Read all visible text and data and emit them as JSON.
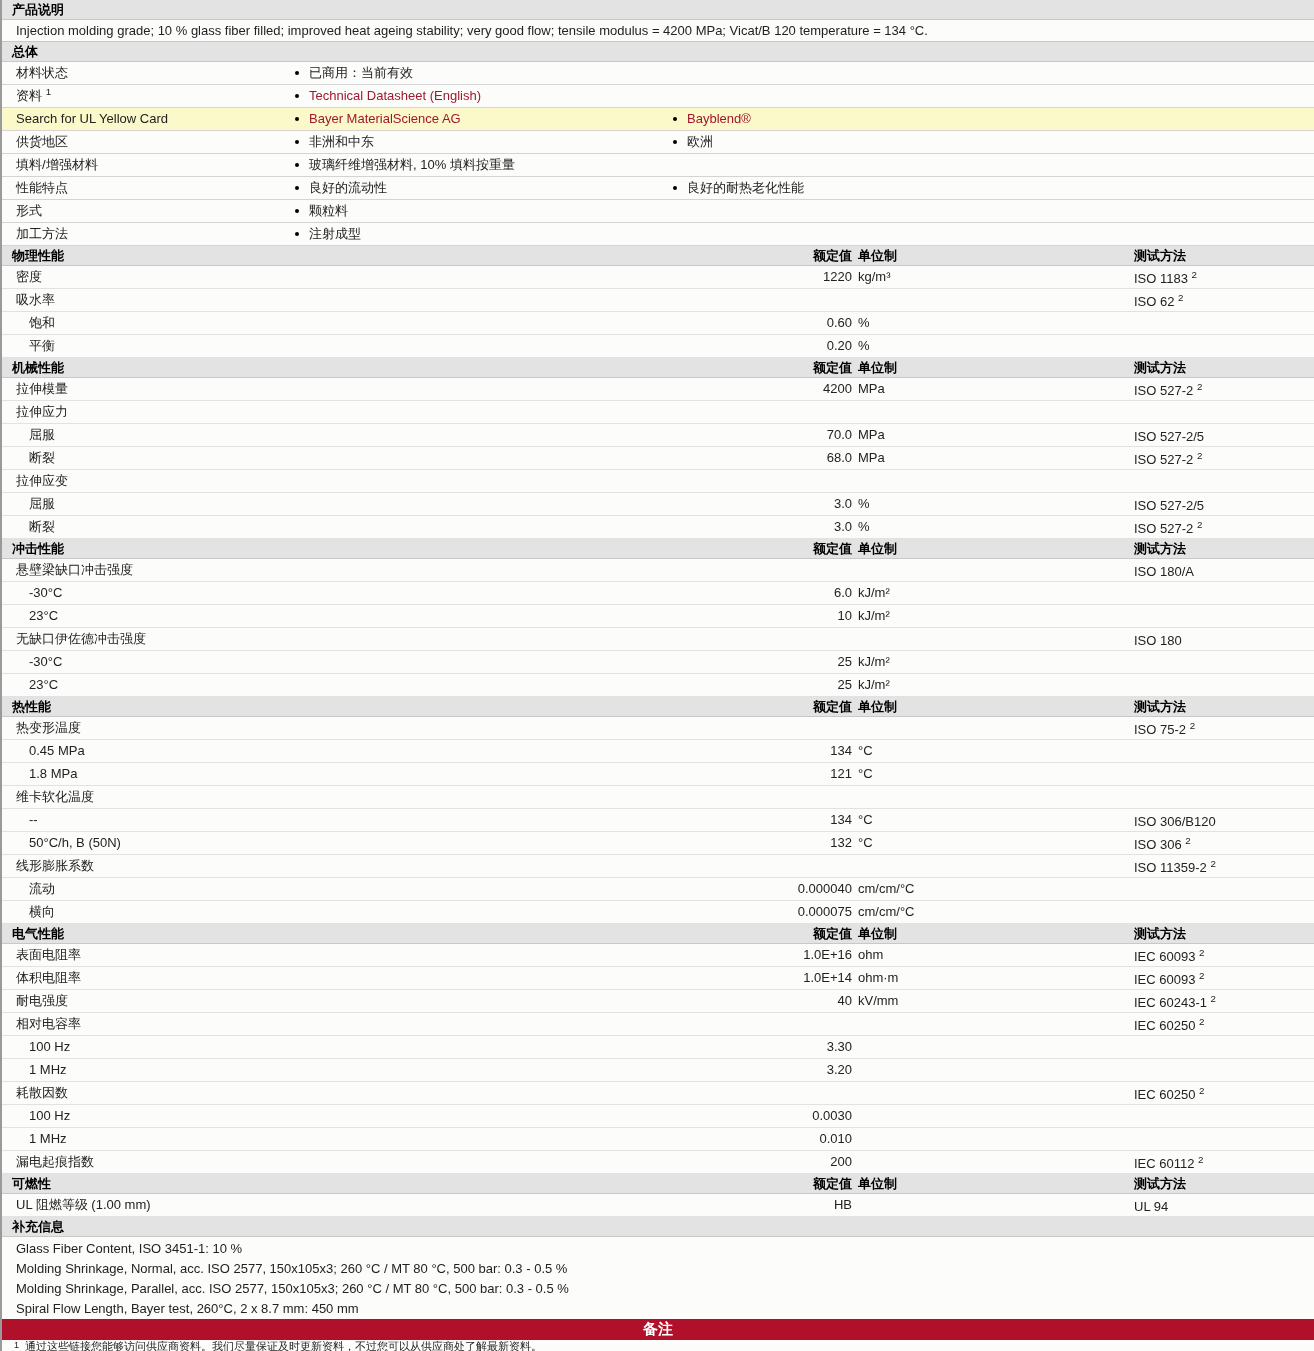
{
  "description": {
    "title": "产品说明",
    "text": "Injection molding grade; 10 % glass fiber filled; improved heat ageing stability; very good flow; tensile modulus = 4200 MPa; Vicat/B 120 temperature = 134 °C."
  },
  "general": {
    "title": "总体",
    "rows": [
      {
        "label": "材料状态",
        "highlighted": false,
        "values": [
          {
            "text": "已商用：当前有效",
            "link": false
          }
        ]
      },
      {
        "label": "资料 $^{1}$",
        "highlighted": false,
        "values": [
          {
            "text": "Technical Datasheet (English)",
            "link": true
          }
        ]
      },
      {
        "label": "Search for UL Yellow Card",
        "highlighted": true,
        "values": [
          {
            "text": "Bayer MaterialScience AG",
            "link": true
          },
          {
            "text": "Bayblend®",
            "link": true
          }
        ]
      },
      {
        "label": "供货地区",
        "highlighted": false,
        "values": [
          {
            "text": "非洲和中东",
            "link": false
          },
          {
            "text": "欧洲",
            "link": false
          }
        ]
      },
      {
        "label": "填料/增强材料",
        "highlighted": false,
        "values": [
          {
            "text": "玻璃纤维增强材料, 10% 填料按重量",
            "link": false
          }
        ]
      },
      {
        "label": "性能特点",
        "highlighted": false,
        "values": [
          {
            "text": "良好的流动性",
            "link": false
          },
          {
            "text": "良好的耐热老化性能",
            "link": false
          }
        ]
      },
      {
        "label": "形式",
        "highlighted": false,
        "values": [
          {
            "text": "颗粒料",
            "link": false
          }
        ]
      },
      {
        "label": "加工方法",
        "highlighted": false,
        "values": [
          {
            "text": "注射成型",
            "link": false
          }
        ]
      }
    ]
  },
  "property_sections": [
    {
      "title": "物理性能",
      "value_heading": "额定值",
      "unit_heading": "单位制",
      "method_heading": "测试方法",
      "rows": [
        {
          "label": "密度",
          "indented": false,
          "value": "1220",
          "unit": "kg/m³",
          "method": "ISO 1183 $^{2}$"
        },
        {
          "label": "吸水率",
          "indented": false,
          "method": "ISO 62 $^{2}$"
        },
        {
          "label": "饱和",
          "indented": true,
          "value": "0.60",
          "unit": "%"
        },
        {
          "label": "平衡",
          "indented": true,
          "value": "0.20",
          "unit": "%"
        }
      ]
    },
    {
      "title": "机械性能",
      "value_heading": "额定值",
      "unit_heading": "单位制",
      "method_heading": "测试方法",
      "rows": [
        {
          "label": "拉伸模量",
          "indented": false,
          "value": "4200",
          "unit": "MPa",
          "method": "ISO 527-2 $^{2}$"
        },
        {
          "label": "拉伸应力",
          "indented": false
        },
        {
          "label": "屈服",
          "indented": true,
          "value": "70.0",
          "unit": "MPa",
          "method": "ISO 527-2/5"
        },
        {
          "label": "断裂",
          "indented": true,
          "value": "68.0",
          "unit": "MPa",
          "method": "ISO 527-2 $^{2}$"
        },
        {
          "label": "拉伸应变",
          "indented": false
        },
        {
          "label": "屈服",
          "indented": true,
          "value": "3.0",
          "unit": "%",
          "method": "ISO 527-2/5"
        },
        {
          "label": "断裂",
          "indented": true,
          "value": "3.0",
          "unit": "%",
          "method": "ISO 527-2 $^{2}$"
        }
      ]
    },
    {
      "title": "冲击性能",
      "value_heading": "额定值",
      "unit_heading": "单位制",
      "method_heading": "测试方法",
      "rows": [
        {
          "label": "悬壁梁缺口冲击强度",
          "indented": false,
          "method": "ISO 180/A"
        },
        {
          "label": "-30°C",
          "indented": true,
          "value": "6.0",
          "unit": "kJ/m²"
        },
        {
          "label": "23°C",
          "indented": true,
          "value": "10",
          "unit": "kJ/m²"
        },
        {
          "label": "无缺口伊佐德冲击强度",
          "indented": false,
          "method": "ISO 180"
        },
        {
          "label": "-30°C",
          "indented": true,
          "value": "25",
          "unit": "kJ/m²"
        },
        {
          "label": "23°C",
          "indented": true,
          "value": "25",
          "unit": "kJ/m²"
        }
      ]
    },
    {
      "title": "热性能",
      "value_heading": "额定值",
      "unit_heading": "单位制",
      "method_heading": "测试方法",
      "rows": [
        {
          "label": "热变形温度",
          "indented": false,
          "method": "ISO 75-2 $^{2}$"
        },
        {
          "label": "0.45 MPa",
          "indented": true,
          "value": "134",
          "unit": "°C"
        },
        {
          "label": "1.8 MPa",
          "indented": true,
          "value": "121",
          "unit": "°C"
        },
        {
          "label": "维卡软化温度",
          "indented": false
        },
        {
          "label": "--",
          "indented": true,
          "value": "134",
          "unit": "°C",
          "method": "ISO 306/B120"
        },
        {
          "label": "50°C/h, B (50N)",
          "indented": true,
          "value": "132",
          "unit": "°C",
          "method": "ISO 306 $^{2}$"
        },
        {
          "label": "线形膨胀系数",
          "indented": false,
          "method": "ISO 11359-2 $^{2}$"
        },
        {
          "label": "流动",
          "indented": true,
          "value": "0.000040",
          "unit": "cm/cm/°C"
        },
        {
          "label": "横向",
          "indented": true,
          "value": "0.000075",
          "unit": "cm/cm/°C"
        }
      ]
    },
    {
      "title": "电气性能",
      "value_heading": "额定值",
      "unit_heading": "单位制",
      "method_heading": "测试方法",
      "rows": [
        {
          "label": "表面电阻率",
          "indented": false,
          "value": "1.0E+16",
          "unit": "ohm",
          "method": "IEC 60093 $^{2}$"
        },
        {
          "label": "体积电阻率",
          "indented": false,
          "value": "1.0E+14",
          "unit": "ohm·m",
          "method": "IEC 60093 $^{2}$"
        },
        {
          "label": "耐电强度",
          "indented": false,
          "value": "40",
          "unit": "kV/mm",
          "method": "IEC 60243-1 $^{2}$"
        },
        {
          "label": "相对电容率",
          "indented": false,
          "method": "IEC 60250 $^{2}$"
        },
        {
          "label": "100 Hz",
          "indented": true,
          "value": "3.30"
        },
        {
          "label": "1 MHz",
          "indented": true,
          "value": "3.20"
        },
        {
          "label": "耗散因数",
          "indented": false,
          "method": "IEC 60250 $^{2}$"
        },
        {
          "label": "100 Hz",
          "indented": true,
          "value": "0.0030"
        },
        {
          "label": "1 MHz",
          "indented": true,
          "value": "0.010"
        },
        {
          "label": "漏电起痕指数",
          "indented": false,
          "value": "200",
          "method": "IEC 60112 $^{2}$"
        }
      ]
    },
    {
      "title": "可燃性",
      "value_heading": "额定值",
      "unit_heading": "单位制",
      "method_heading": "测试方法",
      "rows": [
        {
          "label": "UL 阻燃等级  (1.00 mm)",
          "indented": false,
          "value": "HB",
          "method": "UL 94"
        }
      ]
    }
  ],
  "supplementary": {
    "title": "补充信息",
    "lines": [
      "Glass Fiber Content, ISO 3451-1: 10 %",
      "Molding Shrinkage, Normal, acc. ISO 2577, 150x105x3; 260 °C / MT 80 °C, 500 bar: 0.3 - 0.5 %",
      "Molding Shrinkage, Parallel, acc. ISO 2577, 150x105x3; 260 °C / MT 80 °C, 500 bar: 0.3 - 0.5 %",
      "Spiral Flow Length, Bayer test, 260°C, 2 x 8.7 mm: 450 mm"
    ]
  },
  "notes": {
    "title": "备注",
    "footnotes": [
      {
        "mark": "1",
        "text": "通过这些链接您能够访问供应商资料。我们尽量保证及时更新资料，不过您可以从供应商处了解最新资料。"
      }
    ]
  }
}
